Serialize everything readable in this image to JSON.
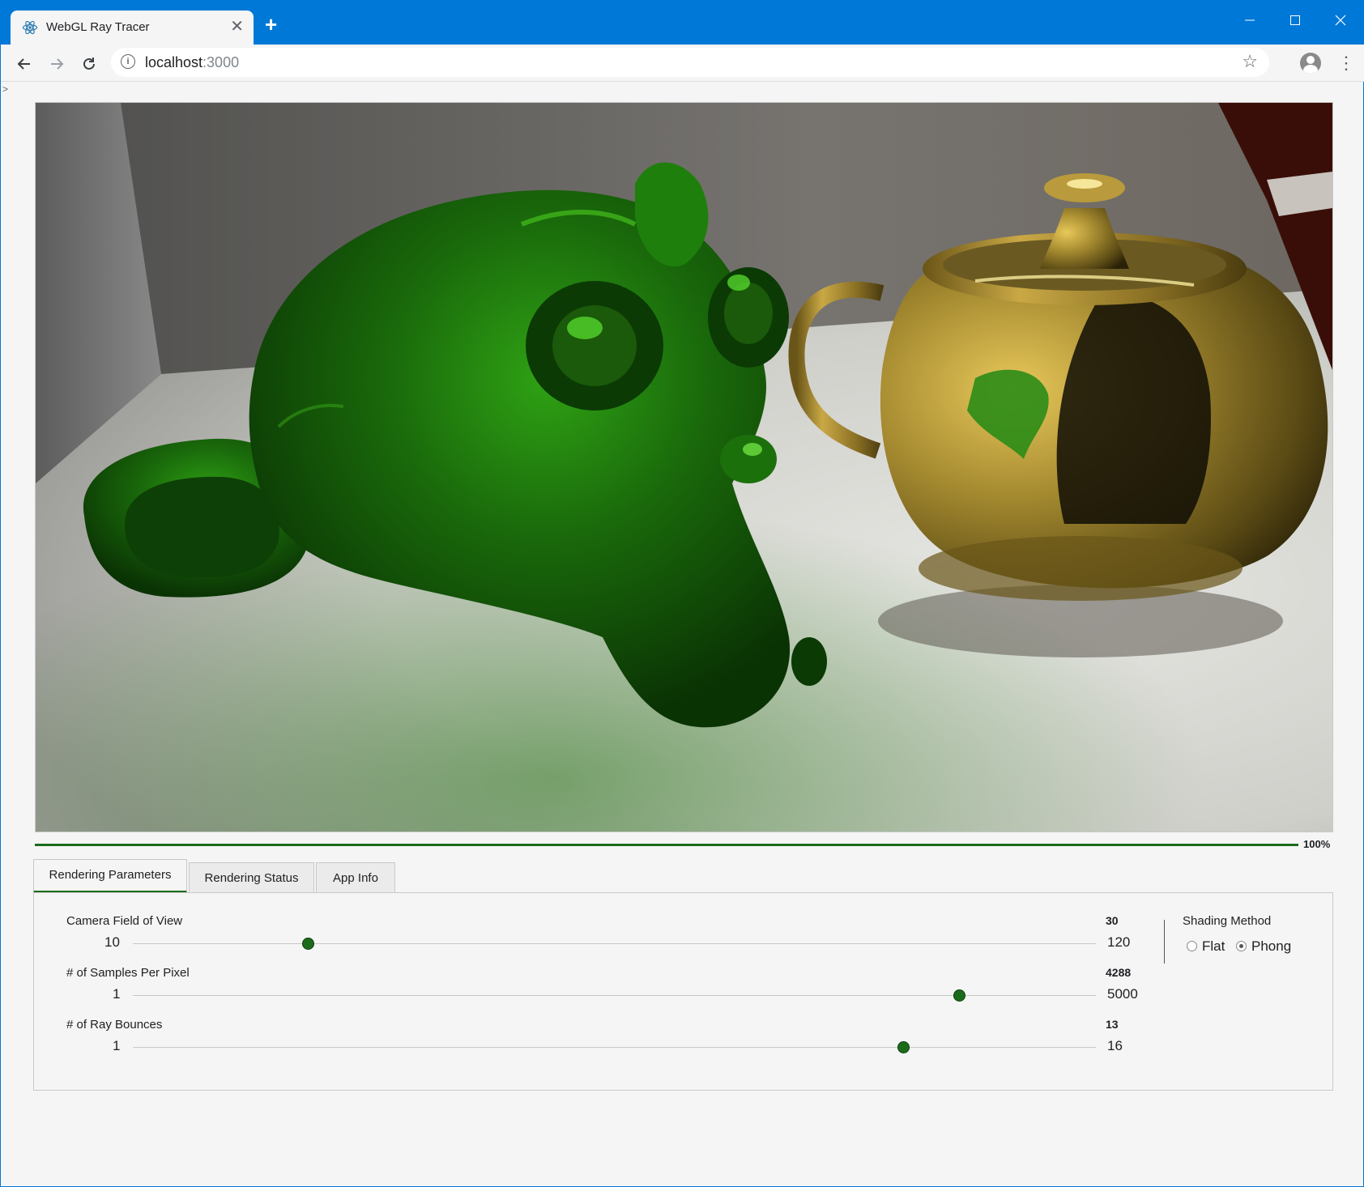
{
  "browser": {
    "tab_title": "WebGL Ray Tracer",
    "tab_close": "✕",
    "new_tab": "+",
    "url_host": "localhost",
    "url_port": ":3000",
    "stray_text": "&gt;"
  },
  "render": {
    "progress_percent": 100,
    "progress_label": "100%"
  },
  "tabs": [
    {
      "label": "Rendering Parameters",
      "active": true
    },
    {
      "label": "Rendering Status",
      "active": false
    },
    {
      "label": "App Info",
      "active": false
    }
  ],
  "params": {
    "fov": {
      "label": "Camera Field of View",
      "min": 10,
      "max": 120,
      "value": 30
    },
    "spp": {
      "label": "# of Samples Per Pixel",
      "min": 1,
      "max": 5000,
      "value": 4288
    },
    "bounces": {
      "label": "# of Ray Bounces",
      "min": 1,
      "max": 16,
      "value": 13
    }
  },
  "shading": {
    "title": "Shading Method",
    "options": [
      {
        "label": "Flat",
        "checked": false
      },
      {
        "label": "Phong",
        "checked": true
      }
    ]
  },
  "colors": {
    "accent": "#1b6b1b",
    "titlebar": "#0078d7"
  }
}
